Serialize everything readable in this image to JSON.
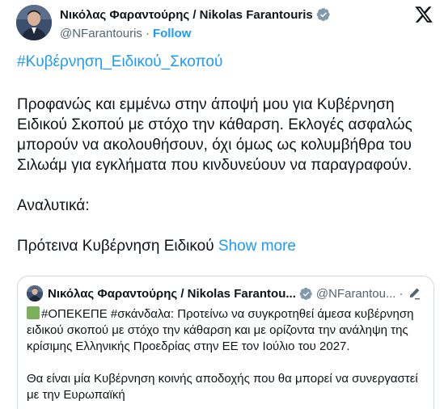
{
  "tweet": {
    "author": {
      "name": "Νικόλας Φαραντούρης / Nikolas Farantouris",
      "handle": "@NFarantouris",
      "separator": "·",
      "follow_label": "Follow"
    },
    "hashtag": "#Κυβέρνηση_Ειδικού_Σκοπού",
    "paragraphs": [
      "Προφανώς και εμμένω στην άποψή μου για Κυβέρνηση Ειδικού Σκοπού με στόχο την κάθαρση. Εκλογές ασφαλώς μπορούν να ακολουθήσουν, όχι όμως ως κολυμβήθρα του Σιλωάμ για εγκλήματα που κινδυνεύουν να παραγραφούν.",
      "Αναλυτικά:"
    ],
    "truncated_text": "Πρότεινα Κυβέρνηση Ειδικού",
    "show_more_label": "Show more",
    "icons": {
      "verified": "verified-badge-icon",
      "platform": "x-logo-icon",
      "edited": "edit-pencil-icon",
      "emoji": "green-square-emoji"
    },
    "colors": {
      "link": "#1d9bf0",
      "text": "#0f1419",
      "secondary": "#536471",
      "border": "#cfd9de"
    }
  },
  "quote": {
    "author_name": "Νικόλας Φαραντούρης / Nikolas Farantou...",
    "handle": "@NFarantou...",
    "separator": "·",
    "line1_text": "#ΟΠΕΚΕΠΕ #σκάνδαλα: Προτείνω να συγκροτηθεί άμεσα κυβέρνηση ειδικού σκοπού με στόχο την κάθαρση και με ορίζοντα την ανάληψη της κρίσιμης Ελληνικής Προεδρίας στην ΕΕ τον Ιούλιο του 2027.",
    "line2_text": "Θα είναι μία Κυβέρνηση κοινής αποδοχής που θα μπορεί να συνεργαστεί με την Ευρωπαϊκή"
  }
}
